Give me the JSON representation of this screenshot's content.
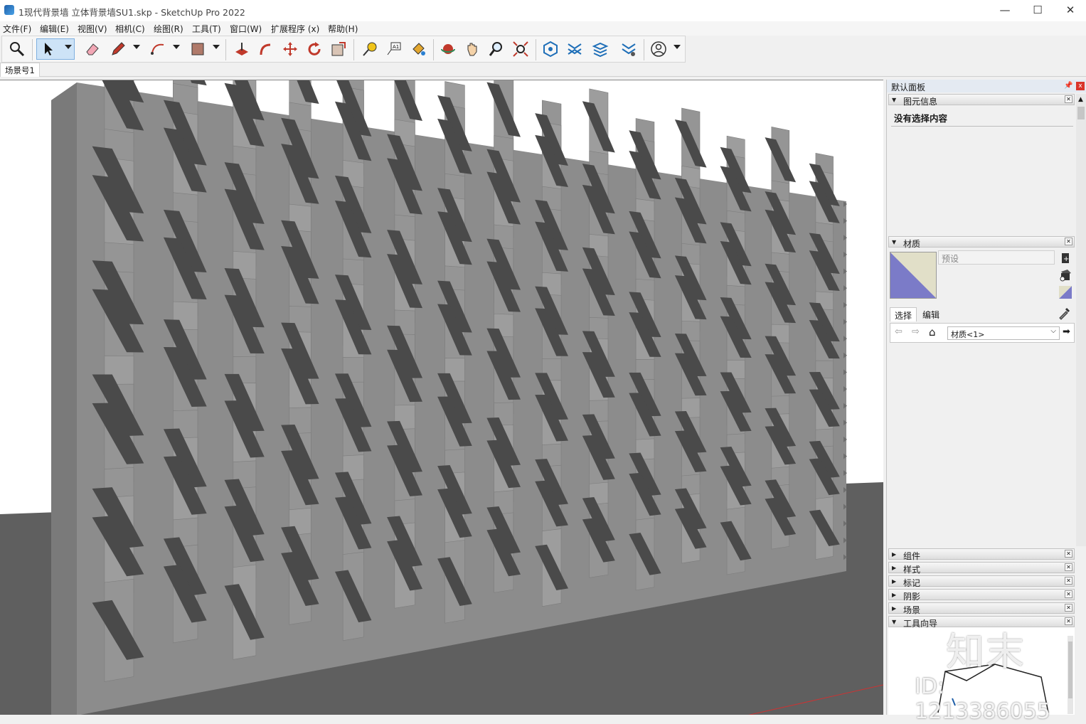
{
  "window": {
    "title": "1现代背景墙 立体背景墙SU1.skp - SketchUp Pro 2022",
    "minimize": "—",
    "maximize": "☐",
    "close": "✕"
  },
  "menu": [
    "文件(F)",
    "编辑(E)",
    "视图(V)",
    "相机(C)",
    "绘图(R)",
    "工具(T)",
    "窗口(W)",
    "扩展程序 (x)",
    "帮助(H)"
  ],
  "scenes": {
    "tab1": "场景号1"
  },
  "tray": {
    "title": "默认面板",
    "pin": "ᵖ",
    "close": "x",
    "entity_info": {
      "header": "图元信息",
      "message": "没有选择内容"
    },
    "materials": {
      "header": "材质",
      "name_placeholder": "预设",
      "tab_select": "选择",
      "tab_edit": "编辑",
      "library": "材质<1>",
      "swatch_colors": {
        "main": "#7b7bc8",
        "bg": "#e1dfc8"
      }
    },
    "collapsed_panels": [
      "组件",
      "样式",
      "标记",
      "阴影",
      "场景"
    ],
    "instructor": {
      "header": "工具向导"
    }
  },
  "watermarks": {
    "logo": "知末",
    "id": "ID: 1213386055"
  },
  "colors": {
    "wall": "#8f8f8f",
    "wall_face": "#9a9a9a",
    "fin_shadow": "#4a4a4a",
    "ground": "#5f5f5f",
    "toolbar_active": "#cde3f7"
  }
}
